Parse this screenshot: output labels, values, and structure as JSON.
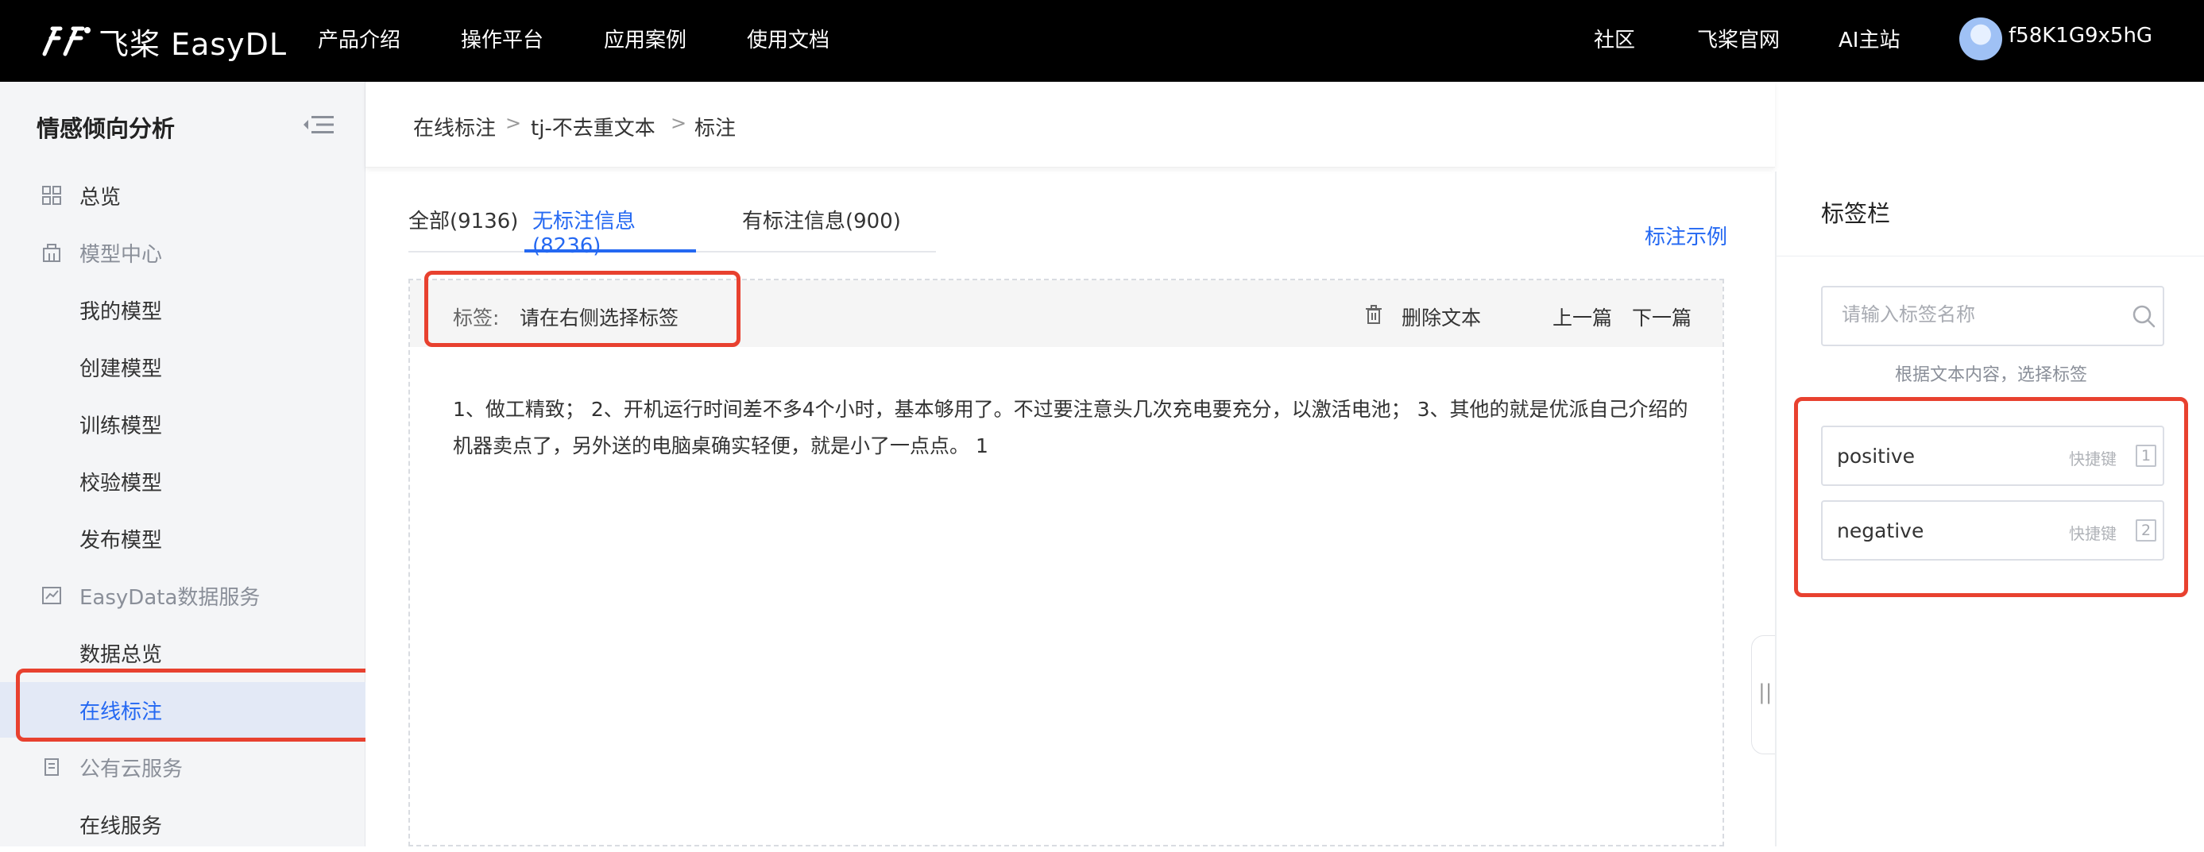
{
  "topbar": {
    "brand": "飞桨 EasyDL",
    "nav": [
      "产品介绍",
      "操作平台",
      "应用案例",
      "使用文档"
    ],
    "right_links": [
      "社区",
      "飞桨官网",
      "AI主站"
    ],
    "username": "f58K1G9x5hG"
  },
  "sidebar": {
    "title": "情感倾向分析",
    "items": [
      {
        "label": "总览"
      },
      {
        "label": "模型中心"
      },
      {
        "label": "我的模型"
      },
      {
        "label": "创建模型"
      },
      {
        "label": "训练模型"
      },
      {
        "label": "校验模型"
      },
      {
        "label": "发布模型"
      },
      {
        "label": "EasyData数据服务"
      },
      {
        "label": "数据总览"
      },
      {
        "label": "在线标注"
      },
      {
        "label": "公有云服务"
      },
      {
        "label": "在线服务"
      }
    ]
  },
  "breadcrumb": [
    "在线标注",
    "tj-不去重文本",
    "标注"
  ],
  "tabs": [
    {
      "label": "全部(9136)"
    },
    {
      "label": "无标注信息(8236)"
    },
    {
      "label": "有标注信息(900)"
    }
  ],
  "example_link": "标注示例",
  "editor": {
    "tag_label": "标签:",
    "tag_value": "请在右侧选择标签",
    "delete_label": "删除文本",
    "prev_label": "上一篇",
    "next_label": "下一篇",
    "text": "1、做工精致； 2、开机运行时间差不多4个小时，基本够用了。不过要注意头几次充电要充分，以激活电池； 3、其他的就是优派自己介绍的机器卖点了，另外送的电脑桌确实轻便，就是小了一点点。 1"
  },
  "handle_glyph": "||",
  "label_panel": {
    "title": "标签栏",
    "search_placeholder": "请输入标签名称",
    "hint": "根据文本内容，选择标签",
    "shortcut_text": "快捷键",
    "labels": [
      {
        "name": "positive",
        "key": "1"
      },
      {
        "name": "negative",
        "key": "2"
      }
    ]
  },
  "colors": {
    "accent": "#2468f2",
    "highlight": "#e8412f",
    "topbar": "#000000"
  }
}
